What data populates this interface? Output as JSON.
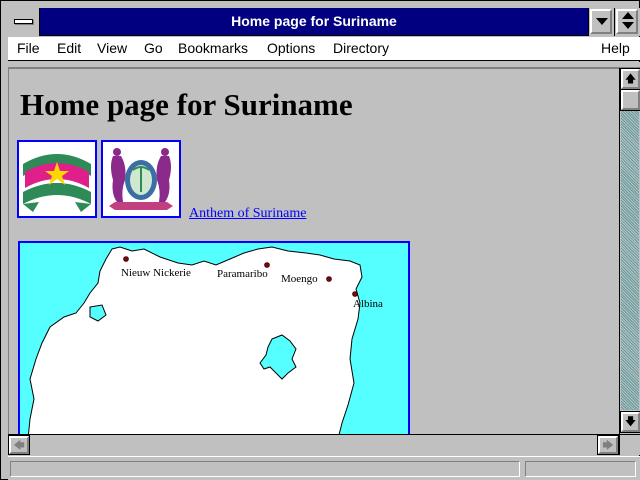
{
  "window": {
    "title": "Home page for Suriname"
  },
  "menubar": {
    "items": [
      {
        "label": "File"
      },
      {
        "label": "Edit"
      },
      {
        "label": "View"
      },
      {
        "label": "Go"
      },
      {
        "label": "Bookmarks"
      },
      {
        "label": "Options"
      },
      {
        "label": "Directory"
      },
      {
        "label": "Help"
      }
    ]
  },
  "page": {
    "heading": "Home page for Suriname",
    "anthem_link": "Anthem of Suriname",
    "map": {
      "cities": [
        {
          "name": "Nieuw Nickerie"
        },
        {
          "name": "Paramaribo"
        },
        {
          "name": "Moengo"
        },
        {
          "name": "Albina"
        }
      ]
    }
  },
  "status": {
    "text": ""
  },
  "colors": {
    "titlebar": "#000080",
    "link": "#0000ff",
    "sea": "#55ffff",
    "chrome": "#c0c0c0"
  },
  "icons": {
    "system_menu": "system-menu-icon",
    "minimize": "minimize-icon",
    "maximize": "maximize-icon",
    "scroll_up": "arrow-up-icon",
    "scroll_down": "arrow-down-icon",
    "scroll_left": "arrow-left-icon",
    "scroll_right": "arrow-right-icon"
  }
}
